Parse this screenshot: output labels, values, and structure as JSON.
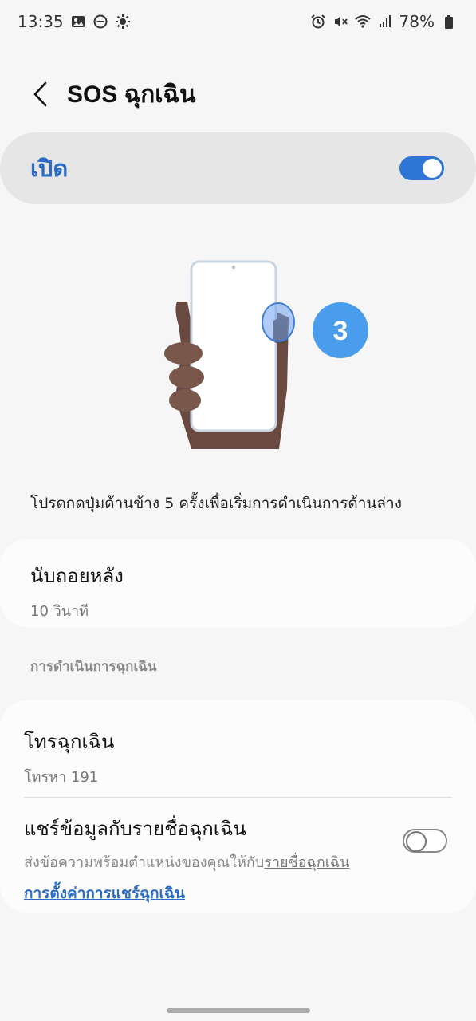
{
  "status_bar": {
    "time": "13:35",
    "battery": "78%",
    "icons_left": [
      "gallery-icon",
      "dnd-icon",
      "brightness-icon"
    ],
    "icons_right": [
      "alarm-icon",
      "mute-icon",
      "wifi-icon",
      "signal-icon",
      "battery-icon"
    ]
  },
  "header": {
    "title": "SOS ฉุกเฉิน"
  },
  "master": {
    "label": "เปิด",
    "enabled": true
  },
  "illustration": {
    "step_number": "3"
  },
  "description": "โปรดกดปุ่มด้านข้าง 5 ครั้งเพื่อเริ่มการดำเนินการด้านล่าง",
  "countdown": {
    "title": "นับถอยหลัง",
    "value": "10 วินาที"
  },
  "section": {
    "label": "การดำเนินการฉุกเฉิน"
  },
  "emergency_call": {
    "title": "โทรฉุกเฉิน",
    "value": "โทรหา 191"
  },
  "share_info": {
    "title": "แชร์ข้อมูลกับรายชื่อฉุกเฉิน",
    "desc_prefix": "ส่งข้อความพร้อมตำแหน่งของคุณให้กับ",
    "desc_link": "รายชื่อฉุกเฉิน",
    "settings_link": "การตั้งค่าการแชร์ฉุกเฉิน",
    "enabled": false
  },
  "colors": {
    "accent": "#2e75d6",
    "background": "#f6f6f6"
  }
}
